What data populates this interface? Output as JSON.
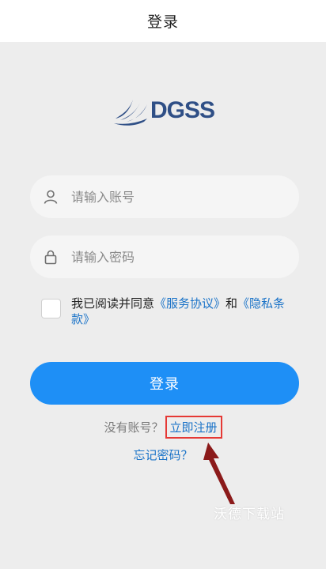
{
  "header": {
    "title": "登录"
  },
  "logo": {
    "brand": "DGSS"
  },
  "login_form": {
    "account_placeholder": "请输入账号",
    "password_placeholder": "请输入密码",
    "account_icon": "user-icon",
    "password_icon": "lock-icon"
  },
  "agreement": {
    "prefix": "我已阅读并同意",
    "service_link": "《服务协议》",
    "and": "和",
    "privacy_link": "《隐私条款》",
    "checked": false
  },
  "buttons": {
    "login": "登录"
  },
  "register": {
    "prompt": "没有账号？",
    "link": "立即注册"
  },
  "forgot_password": "忘记密码？",
  "watermark": "沃德下载站",
  "colors": {
    "primary": "#1e8ff6",
    "link": "#1a73c8",
    "brand": "#2f4f86",
    "highlight": "#e53935",
    "arrow": "#8b1a1a"
  }
}
